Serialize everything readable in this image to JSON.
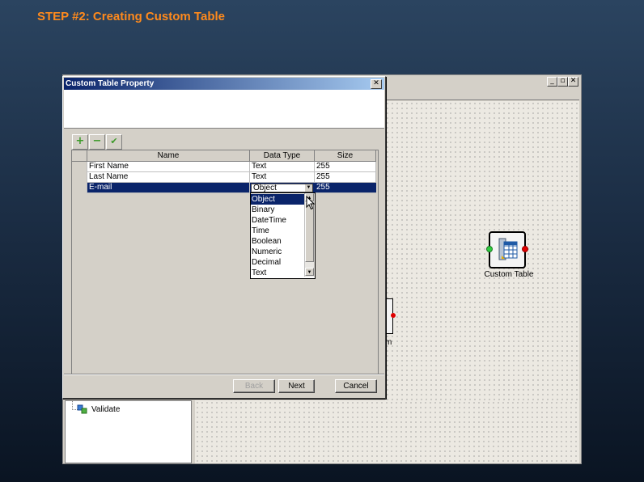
{
  "heading": "STEP #2: Creating Custom Table",
  "dialog": {
    "title": "Custom Table Property",
    "close_glyph": "✕",
    "toolbar": {
      "add": "+",
      "remove": "−",
      "confirm": "✔"
    },
    "columns": [
      "Name",
      "Data Type",
      "Size"
    ],
    "rows": [
      {
        "name": "First Name",
        "type": "Text",
        "size": "255"
      },
      {
        "name": "Last Name",
        "type": "Text",
        "size": "255"
      },
      {
        "name": "E-mail",
        "type": "Object",
        "size": "255"
      }
    ],
    "dropdown_options": [
      "Object",
      "Binary",
      "DateTime",
      "Time",
      "Boolean",
      "Numeric",
      "Decimal",
      "Text"
    ],
    "buttons": {
      "back": "Back",
      "next": "Next",
      "cancel": "Cancel"
    }
  },
  "background": {
    "window_controls": [
      "_",
      "▫",
      "✕"
    ],
    "node_label": "Custom Table",
    "partial_label": "m",
    "tree_item": "Validate"
  },
  "colors": {
    "heading": "#ff8a1c",
    "selection": "#0a246a"
  }
}
